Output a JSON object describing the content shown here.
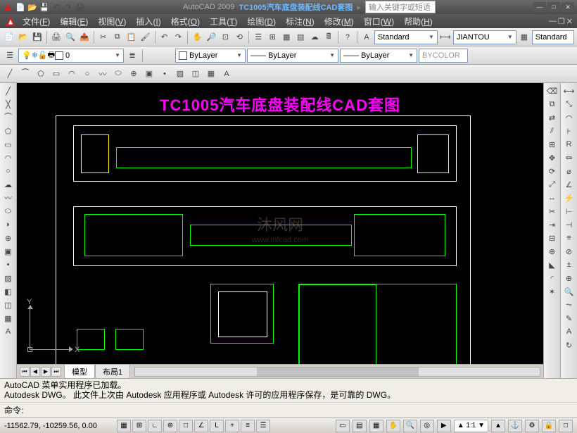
{
  "app": {
    "name": "AutoCAD 2009",
    "document": "TC1005汽车底盘装配线CAD套图",
    "search_placeholder": "输入关键字或短语"
  },
  "menus": [
    {
      "label": "文件",
      "key": "F"
    },
    {
      "label": "编辑",
      "key": "E"
    },
    {
      "label": "视图",
      "key": "V"
    },
    {
      "label": "插入",
      "key": "I"
    },
    {
      "label": "格式",
      "key": "O"
    },
    {
      "label": "工具",
      "key": "T"
    },
    {
      "label": "绘图",
      "key": "D"
    },
    {
      "label": "标注",
      "key": "N"
    },
    {
      "label": "修改",
      "key": "M"
    },
    {
      "label": "窗口",
      "key": "W"
    },
    {
      "label": "帮助",
      "key": "H"
    }
  ],
  "styles": {
    "textstyle": "Standard",
    "dimstyle": "JIANTOU",
    "tablestyle": "Standard"
  },
  "layers": {
    "current": "0",
    "linetype_layer": "ByLayer",
    "lineweight": "ByLayer",
    "linetype": "ByLayer",
    "plotstyle": "BYCOLOR"
  },
  "drawing": {
    "title": "TC1005汽车底盘装配线CAD套图",
    "watermark": "沐风网",
    "watermark_url": "www.mfcad.com"
  },
  "tabs": {
    "model": "模型",
    "layout1": "布局1"
  },
  "ucs": {
    "x": "X",
    "y": "Y"
  },
  "command": {
    "log_line1": "AutoCAD 菜单实用程序已加载。",
    "log_line2": "Autodesk DWG。 此文件上次由 Autodesk 应用程序或 Autodesk 许可的应用程序保存，是可靠的 DWG。",
    "prompt": "命令:"
  },
  "status": {
    "coords": "-11562.79, -10259.56, 0.00",
    "scale": "1:1",
    "annoscale": "▲"
  }
}
